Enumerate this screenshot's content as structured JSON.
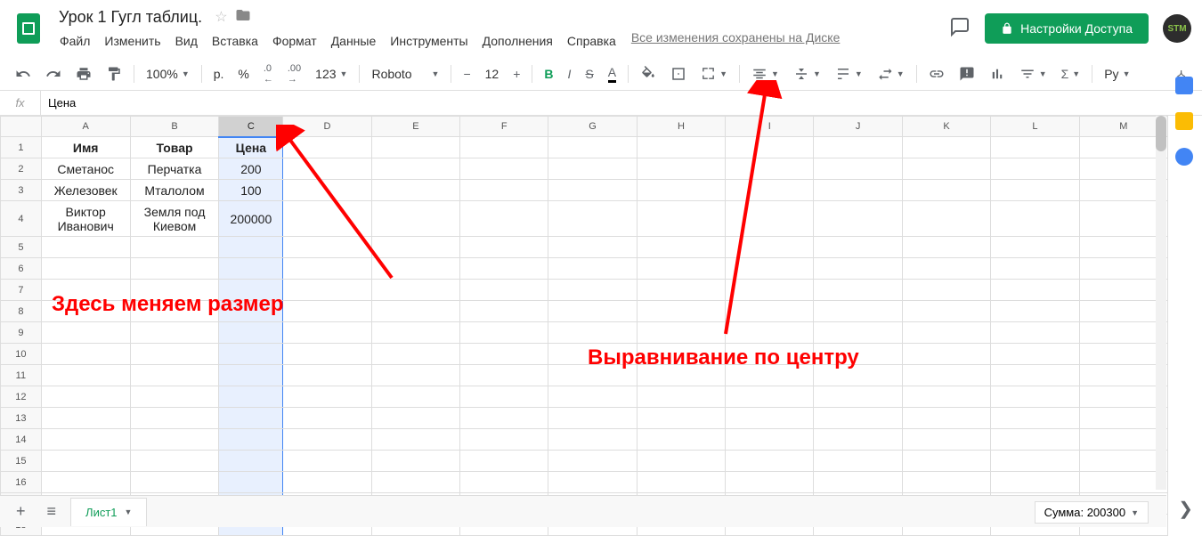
{
  "header": {
    "title": "Урок 1 Гугл таблиц.",
    "menus": [
      "Файл",
      "Изменить",
      "Вид",
      "Вставка",
      "Формат",
      "Данные",
      "Инструменты",
      "Дополнения",
      "Справка"
    ],
    "save_status": "Все изменения сохранены на Диске",
    "share_label": "Настройки Доступа",
    "avatar": "STM"
  },
  "toolbar": {
    "zoom": "100%",
    "currency": "р.",
    "percent": "%",
    "dec_less": ".0",
    "dec_more": ".00",
    "num_format": "123",
    "font": "Roboto",
    "font_size": "12",
    "lang": "Ру"
  },
  "formula": {
    "fx": "fx",
    "value": "Цена"
  },
  "columns": [
    "A",
    "B",
    "C",
    "D",
    "E",
    "F",
    "G",
    "H",
    "I",
    "J",
    "K",
    "L",
    "M"
  ],
  "rows": 18,
  "selected_col": "C",
  "data": {
    "r1": {
      "A": "Имя",
      "B": "Товар",
      "C": "Цена"
    },
    "r2": {
      "A": "Сметанос",
      "B": "Перчатка",
      "C": "200"
    },
    "r3": {
      "A": "Железовек",
      "B": "Мталолом",
      "C": "100"
    },
    "r4": {
      "A": "Виктор Иванович",
      "B": "Земля под Киевом",
      "C": "200000"
    }
  },
  "annotations": {
    "left": "Здесь меняем размер",
    "right": "Выравнивание по центру"
  },
  "tabs": {
    "sheet": "Лист1"
  },
  "status": {
    "sum": "Сумма: 200300"
  }
}
